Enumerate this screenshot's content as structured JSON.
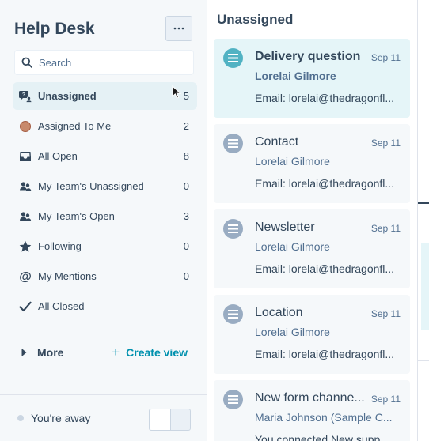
{
  "sidebar": {
    "title": "Help Desk",
    "search_placeholder": "Search",
    "items": [
      {
        "label": "Unassigned",
        "count": "5",
        "icon": "unassigned-icon",
        "active": true
      },
      {
        "label": "Assigned To Me",
        "count": "2",
        "icon": "avatar"
      },
      {
        "label": "All Open",
        "count": "8",
        "icon": "inbox-icon"
      },
      {
        "label": "My Team's Unassigned",
        "count": "0",
        "icon": "team-icon"
      },
      {
        "label": "My Team's Open",
        "count": "3",
        "icon": "team-icon"
      },
      {
        "label": "Following",
        "count": "0",
        "icon": "star-icon"
      },
      {
        "label": "My Mentions",
        "count": "0",
        "icon": "at-icon"
      },
      {
        "label": "All Closed",
        "count": "",
        "icon": "check-icon"
      }
    ],
    "more_label": "More",
    "create_view_label": "Create view",
    "status_text": "You're away"
  },
  "list": {
    "title": "Unassigned",
    "tickets": [
      {
        "subject": "Delivery question",
        "date": "Sep 11",
        "contact": "Lorelai Gilmore",
        "preview": "Email: lorelai@thedragonfl..."
      },
      {
        "subject": "Contact",
        "date": "Sep 11",
        "contact": "Lorelai Gilmore",
        "preview": "Email: lorelai@thedragonfl..."
      },
      {
        "subject": "Newsletter",
        "date": "Sep 11",
        "contact": "Lorelai Gilmore",
        "preview": "Email: lorelai@thedragonfl..."
      },
      {
        "subject": "Location",
        "date": "Sep 11",
        "contact": "Lorelai Gilmore",
        "preview": "Email: lorelai@thedragonfl..."
      },
      {
        "subject": "New form channe...",
        "date": "Sep 11",
        "contact": "Maria Johnson (Sample C...",
        "preview": "You connected New supp..."
      }
    ]
  },
  "colors": {
    "accent": "#0091ae",
    "active_bg": "#e5f5f8",
    "text": "#33475b"
  }
}
